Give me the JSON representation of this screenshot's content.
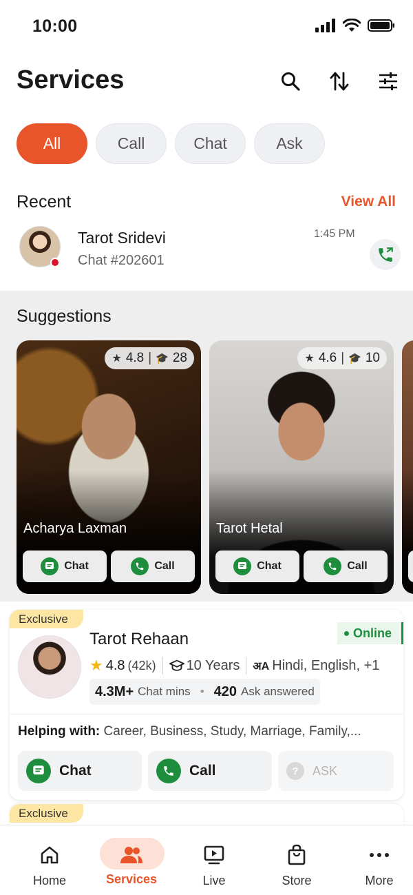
{
  "status_bar": {
    "time": "10:00"
  },
  "header": {
    "title": "Services"
  },
  "filters": [
    {
      "label": "All",
      "active": true
    },
    {
      "label": "Call",
      "active": false
    },
    {
      "label": "Chat",
      "active": false
    },
    {
      "label": "Ask",
      "active": false
    }
  ],
  "recent": {
    "title": "Recent",
    "view_all": "View All",
    "item": {
      "name": "Tarot Sridevi",
      "subtitle": "Chat #202601",
      "time": "1:45 PM"
    }
  },
  "suggestions": {
    "title": "Suggestions",
    "cards": [
      {
        "name": "Acharya Laxman",
        "rating": "4.8",
        "experience": "28",
        "chat_label": "Chat",
        "call_label": "Call"
      },
      {
        "name": "Tarot Hetal",
        "rating": "4.6",
        "experience": "10",
        "chat_label": "Chat",
        "call_label": "Call"
      }
    ]
  },
  "astrologer": {
    "badge": "Exclusive",
    "status": "Online",
    "name": "Tarot Rehaan",
    "rating": "4.8",
    "reviews": "(42k)",
    "experience": "10 Years",
    "languages": "Hindi, English, +1",
    "chat_mins_value": "4.3M+",
    "chat_mins_label": "Chat mins",
    "ask_value": "420",
    "ask_label": "Ask answered",
    "helping_label": "Helping with:",
    "helping_text": "Career, Business, Study, Marriage, Family,...",
    "chat_label": "Chat",
    "call_label": "Call",
    "ask_button_label": "ASK"
  },
  "next_card": {
    "badge": "Exclusive"
  },
  "bottom_nav": [
    {
      "label": "Home",
      "icon": "home-icon"
    },
    {
      "label": "Services",
      "icon": "users-icon",
      "active": true
    },
    {
      "label": "Live",
      "icon": "play-screen-icon"
    },
    {
      "label": "Store",
      "icon": "shopping-bag-icon"
    },
    {
      "label": "More",
      "icon": "more-icon"
    }
  ],
  "colors": {
    "accent": "#e8552a",
    "green": "#1e8e3e",
    "badge_yellow": "#fde6a3"
  }
}
